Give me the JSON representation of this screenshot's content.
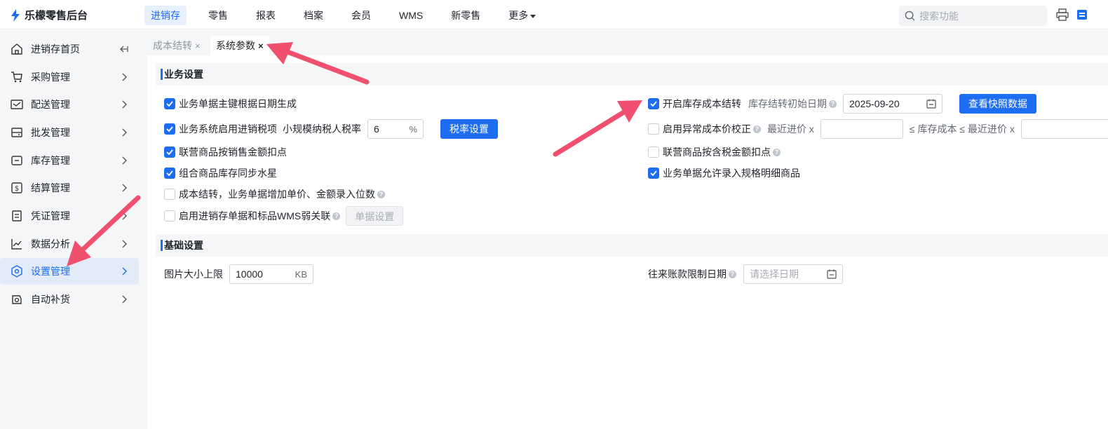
{
  "app": {
    "title": "乐檬零售后台"
  },
  "nav": {
    "items": [
      "进销存",
      "零售",
      "报表",
      "档案",
      "会员",
      "WMS",
      "新零售",
      "更多"
    ],
    "search_placeholder": "搜索功能"
  },
  "sidebar": {
    "items": [
      "进销存首页",
      "采购管理",
      "配送管理",
      "批发管理",
      "库存管理",
      "结算管理",
      "凭证管理",
      "数据分析",
      "设置管理",
      "自动补货"
    ]
  },
  "tabs": [
    {
      "label": "成本结转",
      "close": "×"
    },
    {
      "label": "系统参数",
      "close": "×"
    }
  ],
  "business": {
    "title": "业务设置",
    "left": {
      "opt1": "业务单据主键根据日期生成",
      "opt2": "业务系统启用进销税项",
      "tax_label": "小规模纳税人税率",
      "tax_value": "6",
      "tax_unit": "%",
      "tax_button": "税率设置",
      "opt3": "联营商品按销售金额扣点",
      "opt4": "组合商品库存同步水星",
      "opt5": "成本结转，业务单据增加单价、金额录入位数",
      "opt6": "启用进销存单据和标品WMS弱关联",
      "doc_button": "单据设置"
    },
    "right": {
      "opt1": "开启库存成本结转",
      "date_label": "库存结转初始日期",
      "date_value": "2025-09-20",
      "snapshot_button": "查看快照数据",
      "opt2": "启用异常成本价校正",
      "recent_label": "最近进价 x",
      "range_mid": "≤ 库存成本 ≤ 最近进价 x",
      "opt3": "联营商品按含税金额扣点",
      "opt4": "业务单据允许录入规格明细商品"
    }
  },
  "basic": {
    "title": "基础设置",
    "image_label": "图片大小上限",
    "image_value": "10000",
    "image_unit": "KB",
    "date_limit_label": "往来账款限制日期",
    "date_placeholder": "请选择日期"
  },
  "colors": {
    "primary": "#1d6df2",
    "annotation_arrow": "#f0506e"
  }
}
